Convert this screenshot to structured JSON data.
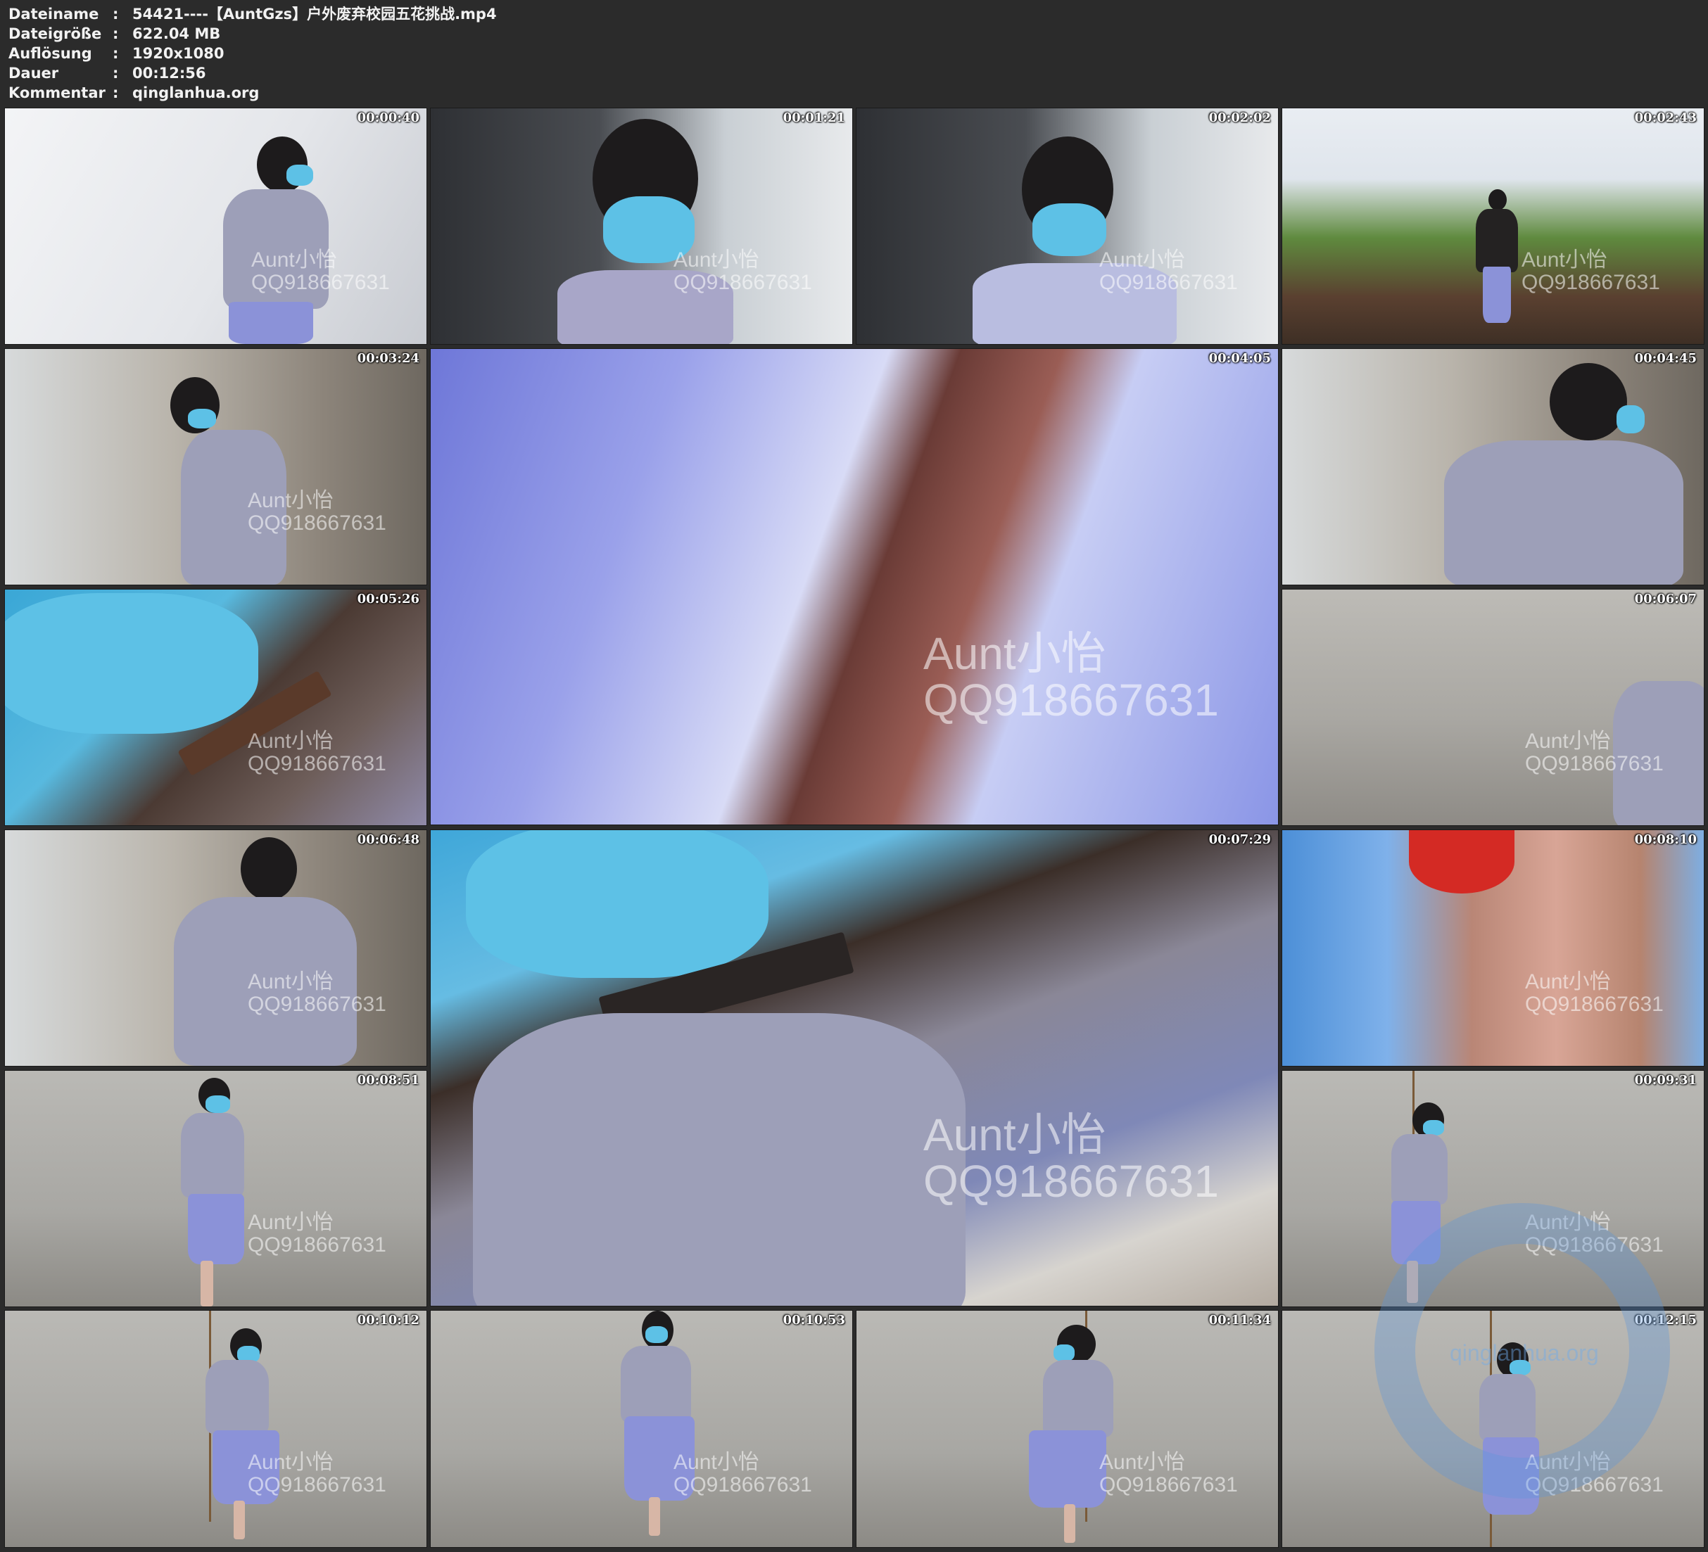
{
  "header": {
    "rows": [
      {
        "key": "Dateiname",
        "colon": ":",
        "value": "54421----【AuntGzs】户外废弃校园五花挑战.mp4"
      },
      {
        "key": "Dateigröße",
        "colon": ":",
        "value": "622.04 MB"
      },
      {
        "key": "Auflösung",
        "colon": ":",
        "value": "1920x1080"
      },
      {
        "key": "Dauer",
        "colon": ":",
        "value": "00:12:56"
      },
      {
        "key": "Kommentar",
        "colon": ":",
        "value": "qinglanhua.org"
      }
    ]
  },
  "watermark": {
    "line1": "Aunt小怡",
    "line2": "QQ918667631",
    "logo_text": "qinglanhua.org"
  },
  "thumbnails": [
    {
      "time": "00:00:40",
      "scene": "staircase"
    },
    {
      "time": "00:01:21",
      "scene": "car"
    },
    {
      "time": "00:02:02",
      "scene": "car"
    },
    {
      "time": "00:02:43",
      "scene": "field"
    },
    {
      "time": "00:03:24",
      "scene": "corridor"
    },
    {
      "time": "00:04:05",
      "scene": "fabric-closeup"
    },
    {
      "time": "00:04:45",
      "scene": "corridor"
    },
    {
      "time": "00:05:26",
      "scene": "mask-closeup"
    },
    {
      "time": "00:06:07",
      "scene": "wall"
    },
    {
      "time": "00:06:48",
      "scene": "corridor"
    },
    {
      "time": "00:07:29",
      "scene": "sweater-closeup"
    },
    {
      "time": "00:08:10",
      "scene": "legs-closeup"
    },
    {
      "time": "00:08:51",
      "scene": "concrete-wall"
    },
    {
      "time": "00:09:31",
      "scene": "concrete-wall"
    },
    {
      "time": "00:10:12",
      "scene": "concrete-wall"
    },
    {
      "time": "00:10:53",
      "scene": "concrete-wall"
    },
    {
      "time": "00:11:34",
      "scene": "concrete-wall"
    },
    {
      "time": "00:12:15",
      "scene": "concrete-wall"
    }
  ]
}
